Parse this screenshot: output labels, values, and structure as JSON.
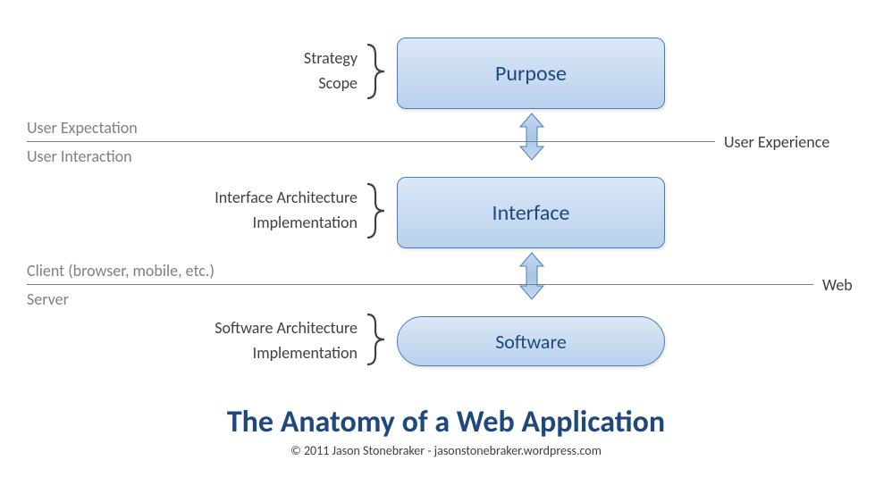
{
  "title": "The Anatomy of a Web Application",
  "credit": "© 2011 Jason Stonebraker - jasonstonebraker.wordpress.com",
  "boxes": {
    "purpose": {
      "label": "Purpose",
      "aspects": [
        "Strategy",
        "Scope"
      ]
    },
    "interface": {
      "label": "Interface",
      "aspects": [
        "Interface Architecture",
        "Implementation"
      ]
    },
    "software": {
      "label": "Software",
      "aspects": [
        "Software Architecture",
        "Implementation"
      ]
    }
  },
  "dividers": {
    "upper": {
      "right": "User Experience",
      "above": "User Expectation",
      "below": "User Interaction"
    },
    "lower": {
      "right": "Web",
      "above": "Client (browser, mobile, etc.)",
      "below": "Server"
    }
  },
  "colors": {
    "box_text": "#1f497d",
    "box_border": "#4a7ebb",
    "box_grad_top": "#dbe7f6",
    "box_grad_bottom": "#b9d1ec",
    "line": "#7f7f7f",
    "muted": "#808080",
    "text": "#404040"
  }
}
